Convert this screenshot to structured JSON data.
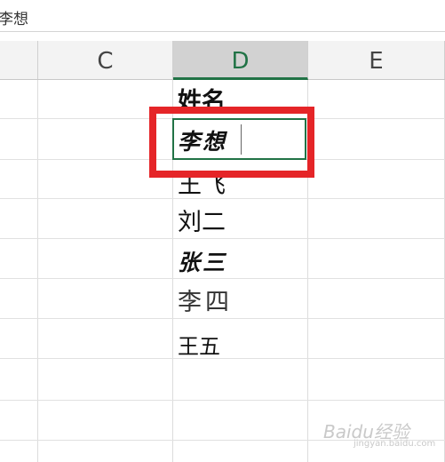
{
  "formula_bar": {
    "value": "李想"
  },
  "columns": [
    {
      "id": "C",
      "selected": false
    },
    {
      "id": "D",
      "selected": true
    },
    {
      "id": "E",
      "selected": false
    }
  ],
  "column_d_cells": [
    {
      "text": "姓名",
      "style": "bold"
    },
    {
      "text": "李想",
      "style": "brush-calligraphy"
    },
    {
      "text": "王飞",
      "style": "regular"
    },
    {
      "text": "刘二",
      "style": "regular"
    },
    {
      "text": "张三",
      "style": "brush-calligraphy"
    },
    {
      "text": "李四",
      "style": "light"
    },
    {
      "text": "王五",
      "style": "regular"
    }
  ],
  "active_cell": {
    "column": "D",
    "value": "李想"
  },
  "highlight_color": "#e52528",
  "accent_color": "#217346",
  "watermark": {
    "text": "Baidu经验",
    "sub": "jingyan.baidu.com"
  }
}
